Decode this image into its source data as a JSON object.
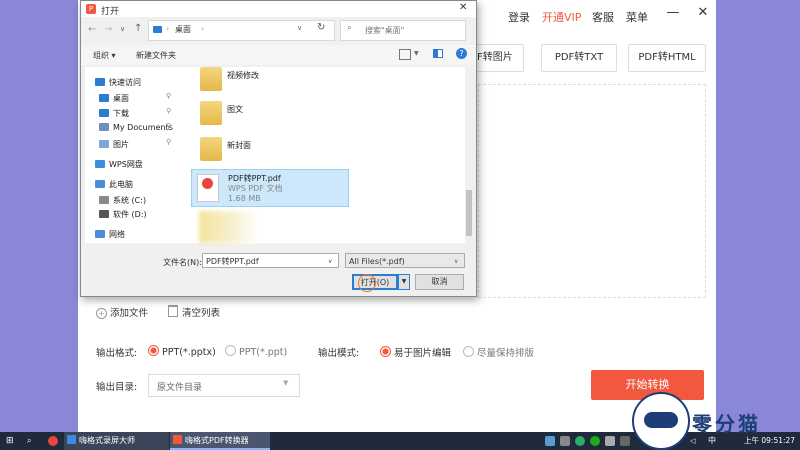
{
  "app": {
    "nav": {
      "login": "登录",
      "vip": "开通VIP",
      "service": "客服",
      "menu": "菜单"
    },
    "window_controls": {
      "minimize": "—",
      "close": "✕"
    },
    "tabs": [
      "PDF转图片",
      "PDF转TXT",
      "PDF转HTML"
    ],
    "actions": {
      "add_file": "添加文件",
      "clear_list": "清空列表"
    },
    "output_format": {
      "label": "输出格式:",
      "options": [
        {
          "label": "PPT(*.pptx)",
          "checked": true
        },
        {
          "label": "PPT(*.ppt)",
          "checked": false
        }
      ]
    },
    "output_mode": {
      "label": "输出模式:",
      "options": [
        {
          "label": "易于图片编辑",
          "checked": true
        },
        {
          "label": "尽量保持排版",
          "checked": false
        }
      ]
    },
    "output_dir": {
      "label": "输出目录:",
      "value": "原文件目录"
    },
    "start_button": "开始转换",
    "accent": "#f1583f"
  },
  "dialog": {
    "title": "打开",
    "address": "桌面",
    "search_placeholder": "搜索\"桌面\"",
    "toolbar": {
      "organize": "组织 ▾",
      "new_folder": "新建文件夹"
    },
    "nav_items": [
      {
        "label": "快速访问",
        "icon": "star-icon",
        "color": "#2b7cd3"
      },
      {
        "label": "桌面",
        "icon": "desktop-icon",
        "color": "#2b7cd3"
      },
      {
        "label": "下载",
        "icon": "download-icon",
        "color": "#2b7cd3"
      },
      {
        "label": "My Documents",
        "icon": "document-icon",
        "color": "#6d8fb8"
      },
      {
        "label": "图片",
        "icon": "pictures-icon",
        "color": "#7aa8d8"
      },
      {
        "label": "WPS网盘",
        "icon": "cloud-icon",
        "color": "#3a8de0"
      },
      {
        "label": "此电脑",
        "icon": "computer-icon",
        "color": "#4b8ed6"
      },
      {
        "label": "系统 (C:)",
        "icon": "drive-icon",
        "color": "#8a8a8a"
      },
      {
        "label": "软件 (D:)",
        "icon": "drive-icon",
        "color": "#555555"
      },
      {
        "label": "网络",
        "icon": "network-icon",
        "color": "#4b8ed6"
      }
    ],
    "files": [
      {
        "name": "视频修改"
      },
      {
        "name": "图文"
      },
      {
        "name": "新封面"
      }
    ],
    "selected_file": {
      "name": "PDF转PPT.pdf",
      "type": "WPS PDF 文档",
      "size": "1.68 MB"
    },
    "filename_label": "文件名(N):",
    "filename_value": "PDF转PPT.pdf",
    "filetype_value": "All Files(*.pdf)",
    "open_button": "打开(O)",
    "cancel_button": "取消"
  },
  "taskbar": {
    "apps": [
      "嗨格式录屏大师",
      "嗨格式PDF转换器"
    ],
    "lang": "中",
    "clock": "上午 09:51:27"
  },
  "watermark": {
    "text": "零分猫"
  }
}
